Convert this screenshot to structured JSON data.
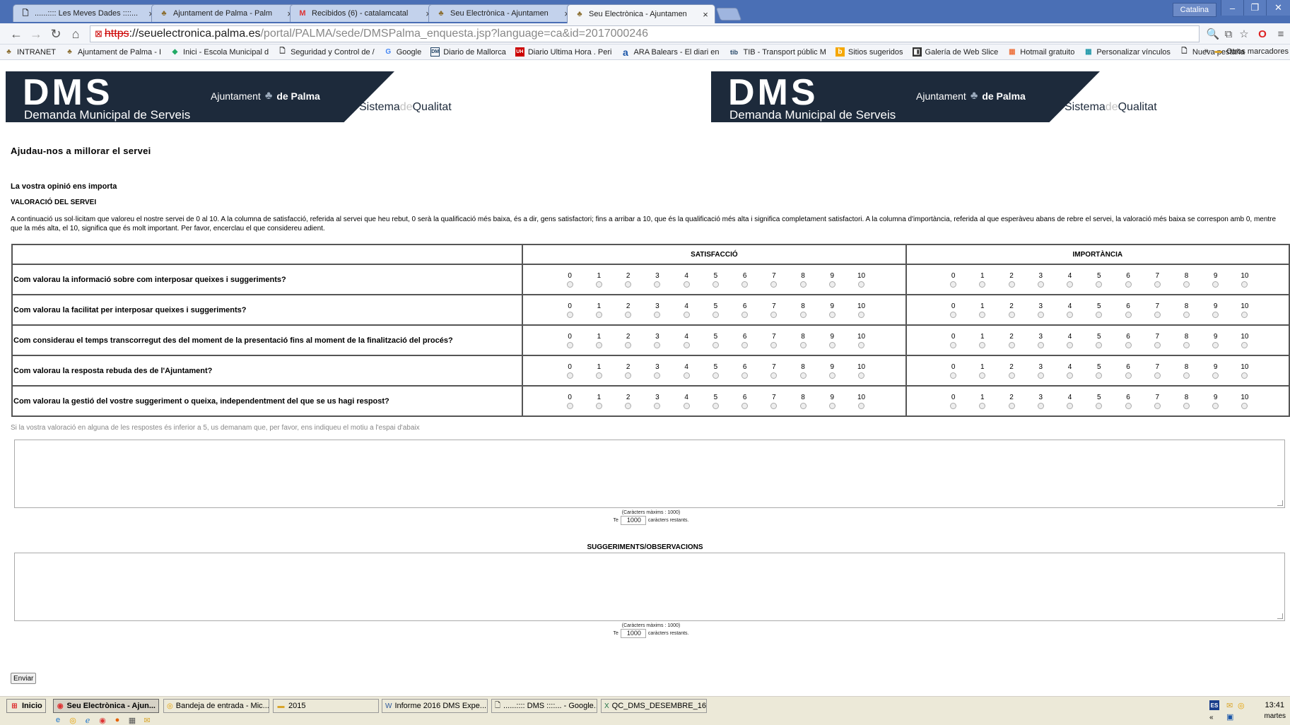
{
  "browser": {
    "tabs": [
      {
        "icon": "document-icon",
        "title": "......:::: Les Meves Dades ::::..."
      },
      {
        "icon": "palma-crest-icon",
        "title": "Ajuntament de Palma - Palm"
      },
      {
        "icon": "gmail-icon",
        "title": "Recibidos (6) - catalamcatal"
      },
      {
        "icon": "palma-crest-icon",
        "title": "Seu Electrònica - Ajuntamen"
      },
      {
        "icon": "palma-crest-icon",
        "title": "Seu Electrònica - Ajuntamen"
      }
    ],
    "user_label": "Catalina",
    "url_scheme": "https",
    "url_host": "://seuelectronica.palma.es",
    "url_path": "/portal/PALMA/sede/DMSPalma_enquesta.jsp?language=ca&id=2017000246",
    "bookmarks": [
      {
        "icon": "palma-crest-icon",
        "label": "INTRANET"
      },
      {
        "icon": "palma-crest-icon",
        "label": "Ajuntament de Palma - I"
      },
      {
        "icon": "diamond-icon",
        "label": "Inici - Escola Municipal d"
      },
      {
        "icon": "document-icon",
        "label": "Seguridad y Control de /"
      },
      {
        "icon": "google-icon",
        "label": "Google"
      },
      {
        "icon": "dm-icon",
        "label": "Diario de Mallorca"
      },
      {
        "icon": "uh-icon",
        "label": "Diario Ultima Hora . Peri"
      },
      {
        "icon": "ara-icon",
        "label": "ARA Balears - El diari en"
      },
      {
        "icon": "tib-icon",
        "label": "TIB - Transport públic M"
      },
      {
        "icon": "bing-icon",
        "label": "Sitios sugeridos"
      },
      {
        "icon": "webslice-icon",
        "label": "Galería de Web Slice"
      },
      {
        "icon": "windows-icon",
        "label": "Hotmail gratuito"
      },
      {
        "icon": "windows-icon",
        "label": "Personalizar vínculos"
      },
      {
        "icon": "document-icon",
        "label": "Nueva pestaña"
      }
    ],
    "bookmarks_more": "»",
    "other_bookmarks": "Otros marcadores"
  },
  "banner": {
    "logo": "DMS",
    "subtitle": "Demanda Municipal de Serveis",
    "ajuntament": "Ajuntament",
    "de_palma": "de Palma",
    "sistema": "Sistema",
    "de": "de",
    "qualitat": "Qualitat"
  },
  "page": {
    "help_title": "Ajudau-nos a millorar el servei",
    "opinion": "La vostra opinió ens importa",
    "valoracio": "VALORACIÓ DEL SERVEI",
    "intro": "A continuació us sol·licitam que valoreu el nostre servei de 0 al 10. A la columna de satisfacció, referida al servei que heu rebut, 0 serà la qualificació més baixa, és a dir, gens satisfactori; fins a arribar a 10, que és la qualificació més alta i significa completament satisfactori. A la columna d'importància, referida al que esperàveu abans de rebre el servei, la valoració més baixa se correspon amb 0, mentre que la més alta, el 10, significa que és molt important. Per favor, encerclau el que considereu adient.",
    "col_satisfaccio": "SATISFACCIÓ",
    "col_importancia": "IMPORTÀNCIA",
    "scale": [
      "0",
      "1",
      "2",
      "3",
      "4",
      "5",
      "6",
      "7",
      "8",
      "9",
      "10"
    ],
    "questions": [
      "Com valorau la informació sobre com interposar queixes i suggeriments?",
      "Com valorau la facilitat per interposar queixes i suggeriments?",
      "Com considerau el temps transcorregut des del moment de la presentació fins al moment de la finalització del procés?",
      "Com valorau la resposta rebuda des de l'Ajuntament?",
      "Com valorau la gestió del vostre suggeriment o queixa, independentment del que se us hagi respost?"
    ],
    "low_note": "Si la vostra valoració en alguna de les respostes és inferior a 5, us demanam que, per favor, ens indiqueu el motiu a l'espai d'abaix",
    "counter_max": "(Caràcters màxims : 1000)",
    "counter_prefix": "Te",
    "counter_value": "1000",
    "counter_suffix": "caràcters restants.",
    "suggeriments_title": "SUGGERIMENTS/OBSERVACIONS",
    "submit_label": "Enviar"
  },
  "taskbar": {
    "start_label": "Inicio",
    "tasks": [
      {
        "icon": "chrome-icon",
        "label": "Seu Electrònica - Ajun..."
      },
      {
        "icon": "outlook-icon",
        "label": "Bandeja de entrada - Mic..."
      },
      {
        "icon": "folder-icon",
        "label": "2015"
      },
      {
        "icon": "word-icon",
        "label": "Informe 2016 DMS Expe..."
      },
      {
        "icon": "document-icon",
        "label": "......:::: DMS ::::... - Google..."
      },
      {
        "icon": "excel-icon",
        "label": "QC_DMS_DESEMBRE_16..."
      }
    ],
    "lang": "ES",
    "time": "13:41",
    "day": "martes"
  }
}
